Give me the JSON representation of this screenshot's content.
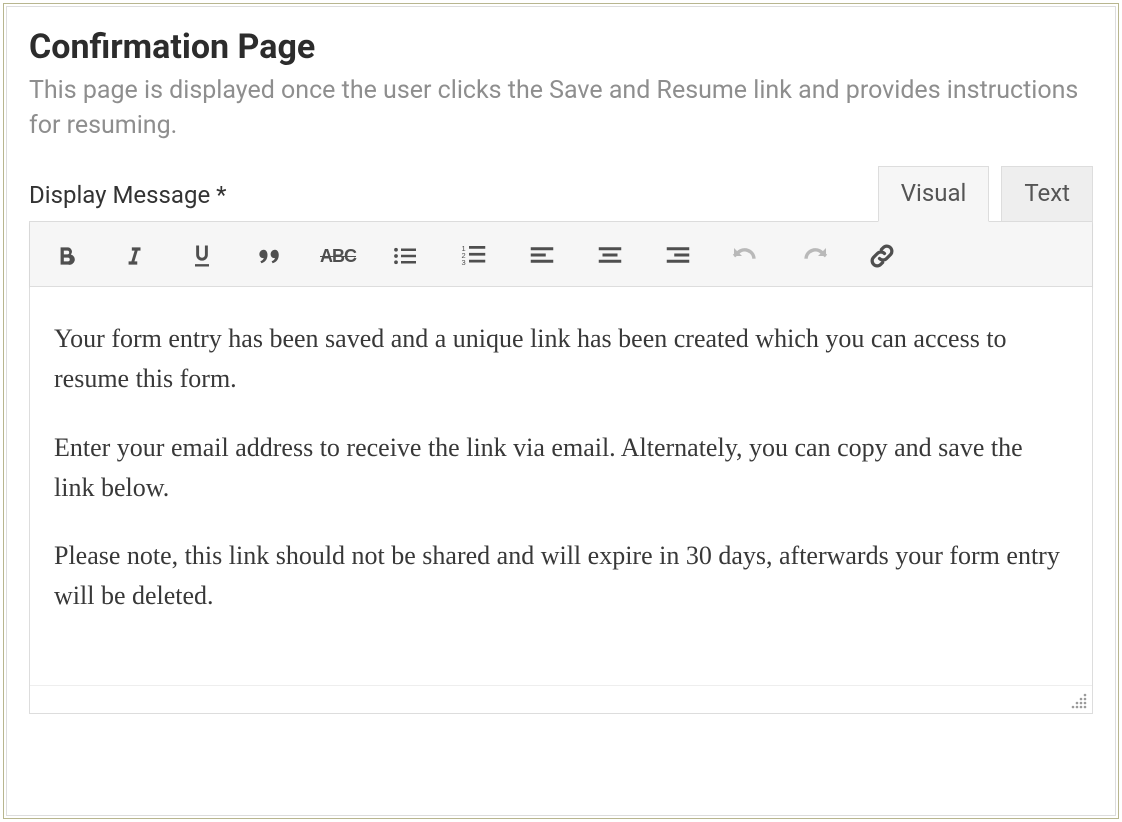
{
  "header": {
    "title": "Confirmation Page",
    "description": "This page is displayed once the user clicks the Save and Resume link and provides instructions for resuming."
  },
  "field": {
    "label": "Display Message *"
  },
  "tabs": {
    "visual": "Visual",
    "text": "Text"
  },
  "toolbar": {
    "bold": "Bold",
    "italic": "Italic",
    "underline": "Underline",
    "blockquote": "Blockquote",
    "strikethrough": "Strikethrough",
    "ul": "Bulleted list",
    "ol": "Numbered list",
    "align_left": "Align left",
    "align_center": "Align center",
    "align_right": "Align right",
    "undo": "Undo",
    "redo": "Redo",
    "link": "Insert link"
  },
  "content": {
    "p1": "Your form entry has been saved and a unique link has been created which you can access to resume this form.",
    "p2": "Enter your email address to receive the link via email. Alternately, you can copy and save the link below.",
    "p3": "Please note, this link should not be shared and will expire in 30 days, afterwards your form entry will be deleted."
  }
}
